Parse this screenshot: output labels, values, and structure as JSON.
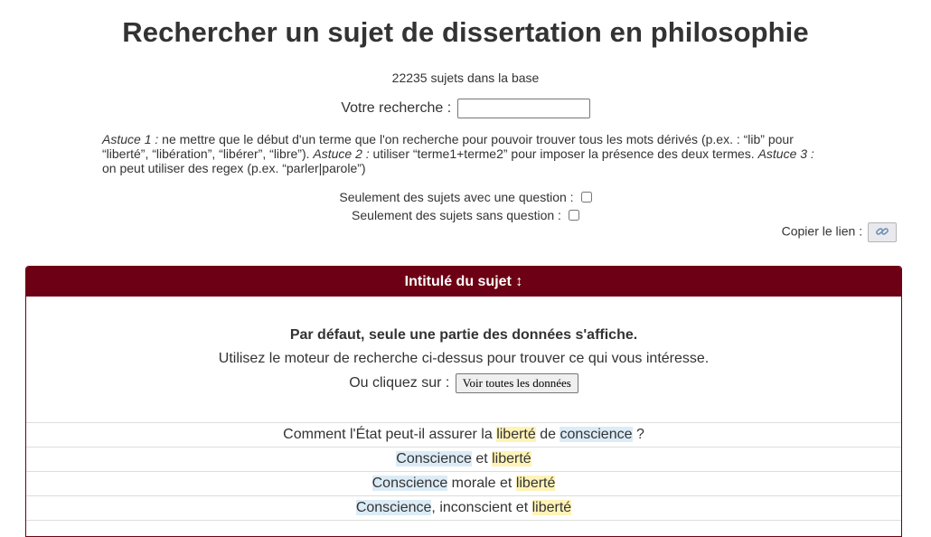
{
  "page": {
    "title": "Rechercher un sujet de dissertation en philosophie",
    "count": "22235 sujets dans la base"
  },
  "search": {
    "label": "Votre recherche :",
    "value": "",
    "placeholder": ""
  },
  "tips": {
    "t1_label": "Astuce 1 :",
    "t1_text": " ne mettre que le début d'un terme que l'on recherche pour pouvoir trouver tous les mots dérivés (p.ex. : “lib” pour “liberté”, “libération”, “libérer”, “libre”). ",
    "t2_label": "Astuce 2 :",
    "t2_text": " utiliser “terme1+terme2” pour imposer la présence des deux termes. ",
    "t3_label": "Astuce 3 :",
    "t3_text": " on peut utiliser des regex (p.ex. “parler|parole”)"
  },
  "options": {
    "with_question": "Seulement des sujets avec une question :",
    "without_question": "Seulement des sujets sans question :"
  },
  "copy": {
    "label": "Copier le lien :",
    "icon": "link-icon"
  },
  "table": {
    "header": "Intitulé du sujet ↕",
    "notice_bold": "Par défaut, seule une partie des données s'affiche.",
    "notice_text": "Utilisez le moteur de recherche ci-dessus pour trouver ce qui vous intéresse.",
    "notice_click": "Ou cliquez sur :",
    "show_all_button": "Voir toutes les données",
    "rows": [
      [
        {
          "t": "Comment l'État peut-il assurer la "
        },
        {
          "t": "liberté",
          "h": "y"
        },
        {
          "t": " de "
        },
        {
          "t": "conscience",
          "h": "b"
        },
        {
          "t": " ?"
        }
      ],
      [
        {
          "t": "Conscience",
          "h": "b"
        },
        {
          "t": " et "
        },
        {
          "t": "liberté",
          "h": "y"
        }
      ],
      [
        {
          "t": "Conscience",
          "h": "b"
        },
        {
          "t": " morale et "
        },
        {
          "t": "liberté",
          "h": "y"
        }
      ],
      [
        {
          "t": "Conscience",
          "h": "b"
        },
        {
          "t": ", inconscient et "
        },
        {
          "t": "liberté",
          "h": "y"
        }
      ]
    ]
  },
  "colors": {
    "header_bg": "#6d0014",
    "highlight_yellow": "#fff3b8",
    "highlight_blue": "#dcecf7"
  }
}
